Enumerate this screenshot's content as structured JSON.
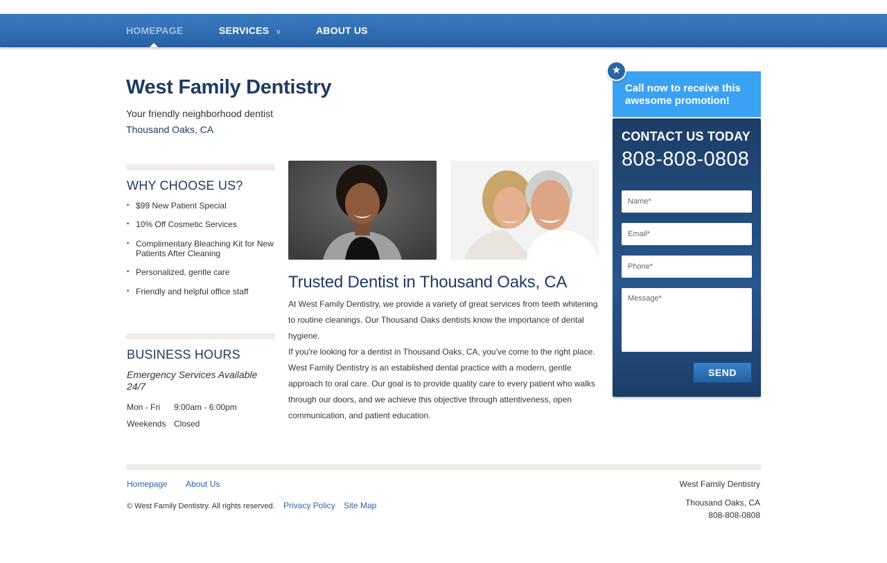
{
  "nav": {
    "items": [
      {
        "label": "HOMEPAGE",
        "active": true
      },
      {
        "label": "SERVICES",
        "has_dropdown": true
      },
      {
        "label": "ABOUT US"
      }
    ]
  },
  "header": {
    "title": "West Family Dentistry",
    "tagline": "Your friendly neighborhood dentist",
    "location": "Thousand Oaks, CA"
  },
  "why": {
    "heading": "WHY CHOOSE US?",
    "items": [
      "$99 New Patient Special",
      "10% Off Cosmetic Services",
      "Complimentary Bleaching Kit for New Patients After Cleaning",
      "Personalized, gentle care",
      "Friendly and helpful office staff"
    ]
  },
  "hours": {
    "heading": "BUSINESS HOURS",
    "emergency": "Emergency Services Available 24/7",
    "rows": [
      {
        "day": "Mon - Fri",
        "time": "9:00am - 6:00pm"
      },
      {
        "day": "Weekends",
        "time": "Closed"
      }
    ]
  },
  "main": {
    "heading": "Trusted Dentist in Thousand Oaks, CA",
    "paragraph1": "At West Family Dentistry, we provide a variety of great services from teeth whitening to routine cleanings. Our Thousand Oaks dentists know the importance of dental hygiene.",
    "paragraph2": "If you're looking for a dentist in Thousand Oaks, CA, you've come to the right place. West Family Dentistry is an established dental practice with a modern, gentle approach to oral care. Our goal is to provide quality care to every patient who walks through our doors, and we achieve this objective through attentiveness, open communication, and patient education."
  },
  "contact": {
    "promo": "Call now to receive this awesome promotion!",
    "title": "CONTACT US TODAY",
    "phone": "808-808-0808",
    "name_placeholder": "Name*",
    "email_placeholder": "Email*",
    "phone_placeholder": "Phone*",
    "message_placeholder": "Message*",
    "send_label": "SEND"
  },
  "footer": {
    "links": [
      "Homepage",
      "About Us"
    ],
    "copyright": "© West Family Dentistry. All rights reserved.",
    "privacy": "Privacy Policy",
    "sitemap": "Site Map",
    "company": "West Family Dentistry",
    "city": "Thousand Oaks, CA",
    "phone": "808-808-0808"
  },
  "colors": {
    "nav": "#2d6bb0",
    "heading": "#1e3a62",
    "promo": "#3aa2f2",
    "contact_box": "#1f4674",
    "link": "#2a64a8"
  }
}
